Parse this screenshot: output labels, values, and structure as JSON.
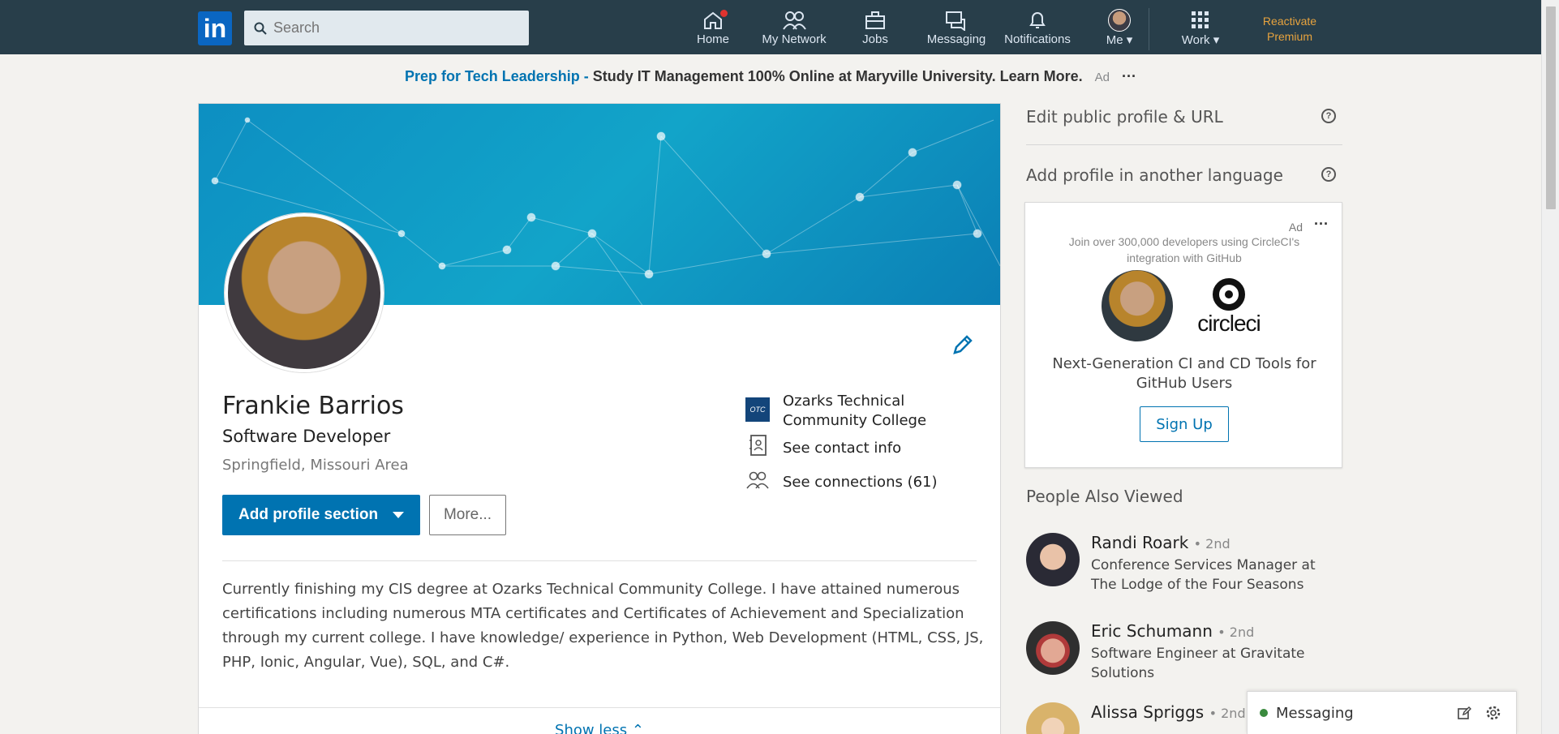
{
  "nav": {
    "logo": "in",
    "search_placeholder": "Search",
    "items": [
      {
        "label": "Home"
      },
      {
        "label": "My Network"
      },
      {
        "label": "Jobs"
      },
      {
        "label": "Messaging"
      },
      {
        "label": "Notifications"
      },
      {
        "label": "Me"
      },
      {
        "label": "Work"
      }
    ],
    "premium_line1": "Reactivate",
    "premium_line2": "Premium"
  },
  "ad_strip": {
    "link_text": "Prep for Tech Leadership -",
    "text": "Study IT Management 100% Online at Maryville University. Learn More.",
    "ad_label": "Ad",
    "dots": "···"
  },
  "profile": {
    "name": "Frankie Barrios",
    "headline": "Software Developer",
    "location": "Springfield, Missouri Area",
    "add_section_label": "Add profile section",
    "more_label": "More...",
    "education": "Ozarks Technical Community College",
    "education_logo": "OTC",
    "contact_info": "See contact info",
    "connections": "See connections (61)",
    "summary": "Currently finishing my CIS degree at Ozarks Technical Community College. I have attained numerous certifications including numerous MTA certificates and Certificates of Achievement and Specialization through my current college. I have knowledge/ experience in Python, Web Development (HTML, CSS, JS, PHP, Ionic, Angular, Vue), SQL, and C#.",
    "show_less": "Show less"
  },
  "rail": {
    "edit_profile": "Edit public profile & URL",
    "add_language": "Add profile in another language",
    "help": "?",
    "ad": {
      "label": "Ad",
      "dots": "···",
      "text": "Join over 300,000 developers using CircleCI's integration with GitHub",
      "brand": "circleci",
      "tagline": "Next-Generation CI and CD Tools for GitHub Users",
      "cta": "Sign Up"
    },
    "people_title": "People Also Viewed",
    "people": [
      {
        "name": "Randi Roark",
        "degree": "• 2nd",
        "title": "Conference Services Manager at The Lodge of the Four Seasons"
      },
      {
        "name": "Eric Schumann",
        "degree": "• 2nd",
        "title": "Software Engineer at Gravitate Solutions"
      },
      {
        "name": "Alissa Spriggs",
        "degree": "• 2nd",
        "title": ""
      }
    ]
  },
  "messaging": {
    "label": "Messaging"
  }
}
